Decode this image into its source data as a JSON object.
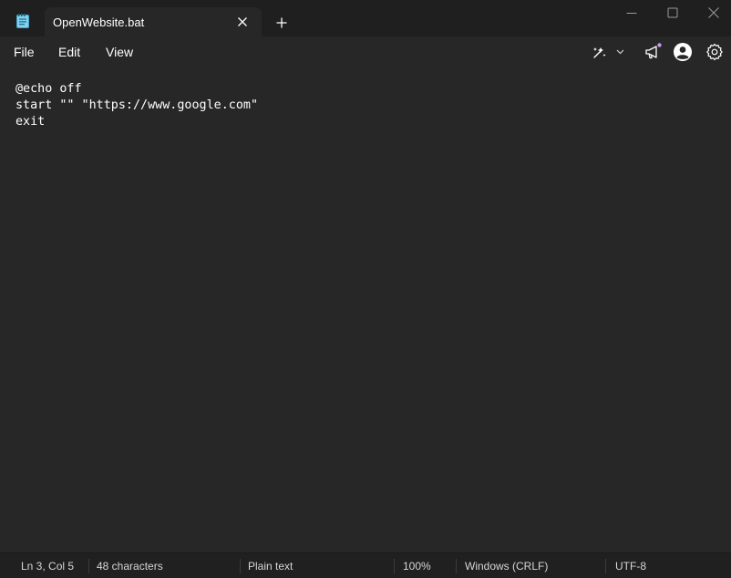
{
  "window": {
    "tab_title": "OpenWebsite.bat",
    "icons": {
      "app": "notepad-icon",
      "close_tab": "close-icon",
      "new_tab": "plus-icon",
      "minimize": "minimize-icon",
      "maximize": "maximize-icon",
      "close": "close-icon"
    }
  },
  "menu": {
    "file": "File",
    "edit": "Edit",
    "view": "View",
    "tools": [
      "copilot-icon",
      "chevron-down-icon",
      "announcement-icon",
      "account-icon",
      "settings-icon"
    ]
  },
  "editor": {
    "lines": [
      "@echo off",
      "start \"\" \"https://www.google.com\"",
      "exit"
    ]
  },
  "status": {
    "position": "Ln 3, Col 5",
    "characters": "48 characters",
    "format": "Plain text",
    "zoom": "100%",
    "line_endings": "Windows (CRLF)",
    "encoding": "UTF-8"
  },
  "colors": {
    "titlebar": "#1f1f1f",
    "background": "#272727",
    "statusbar": "#202020",
    "notepad_icon": "#7fd1f0",
    "notification_dot": "#c59be8"
  }
}
